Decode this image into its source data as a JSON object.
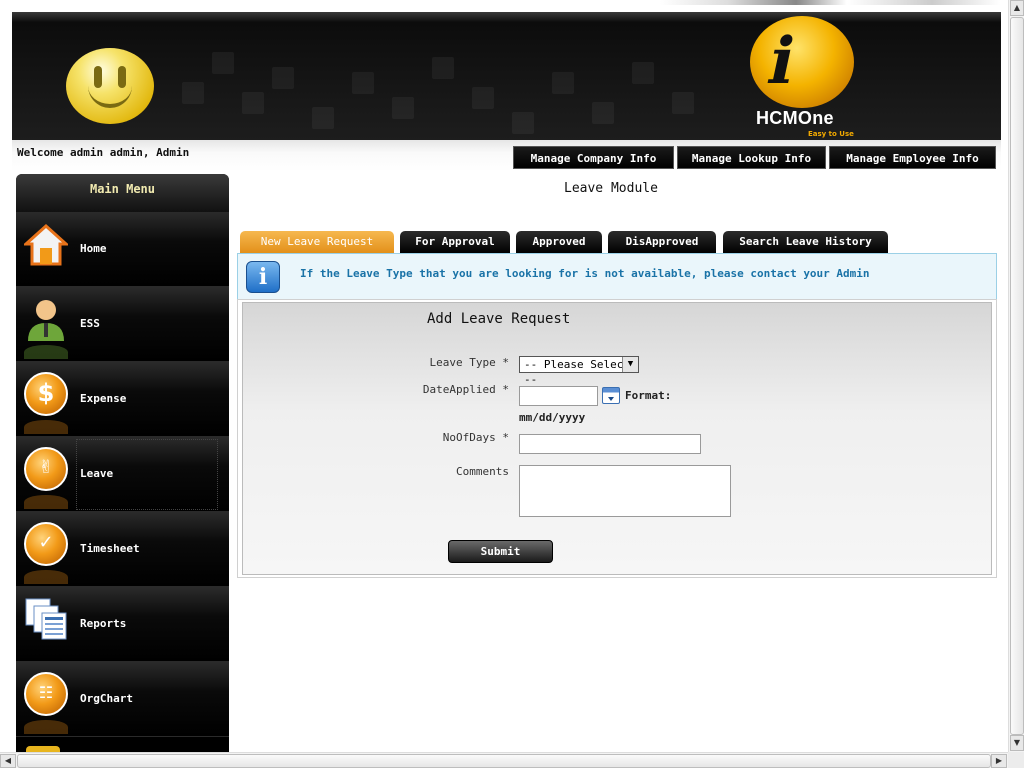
{
  "header": {
    "logo_text": "HCMOne",
    "logo_tagline": "Easy to Use",
    "welcome": "Welcome  admin  admin,  Admin",
    "admin_buttons": [
      "Manage Company Info",
      "Manage Lookup Info",
      "Manage Employee Info"
    ]
  },
  "sidebar": {
    "title": "Main Menu",
    "items": [
      {
        "label": "Home",
        "icon": "home-icon"
      },
      {
        "label": "ESS",
        "icon": "employee-icon"
      },
      {
        "label": "Expense",
        "icon": "dollar-icon"
      },
      {
        "label": "Leave",
        "icon": "leave-icon"
      },
      {
        "label": "Timesheet",
        "icon": "clock-icon"
      },
      {
        "label": "Reports",
        "icon": "reports-icon"
      },
      {
        "label": "OrgChart",
        "icon": "orgchart-icon"
      }
    ],
    "active": "Leave"
  },
  "main": {
    "module_title": "Leave Module",
    "tabs": [
      {
        "label": "New Leave Request",
        "active": true
      },
      {
        "label": "For Approval",
        "active": false
      },
      {
        "label": "Approved",
        "active": false
      },
      {
        "label": "DisApproved",
        "active": false
      },
      {
        "label": "Search Leave History",
        "active": false
      }
    ],
    "info_message": "If the Leave Type that you are looking for is not available, please contact your Admin",
    "form": {
      "title": "Add Leave Request",
      "leave_type_label": "Leave Type *",
      "leave_type_value": "-- Please Select --",
      "date_applied_label": "DateApplied *",
      "date_applied_value": "",
      "format_label": "Format:",
      "format_value": "mm/dd/yyyy",
      "no_of_days_label": "NoOfDays *",
      "no_of_days_value": "",
      "comments_label": "Comments",
      "comments_value": "",
      "submit_label": "Submit"
    }
  },
  "colors": {
    "active_tab": "#e8971f",
    "info_text": "#1a73a7",
    "info_bg": "#eaf6fb",
    "menu_title": "#f1eab0"
  }
}
